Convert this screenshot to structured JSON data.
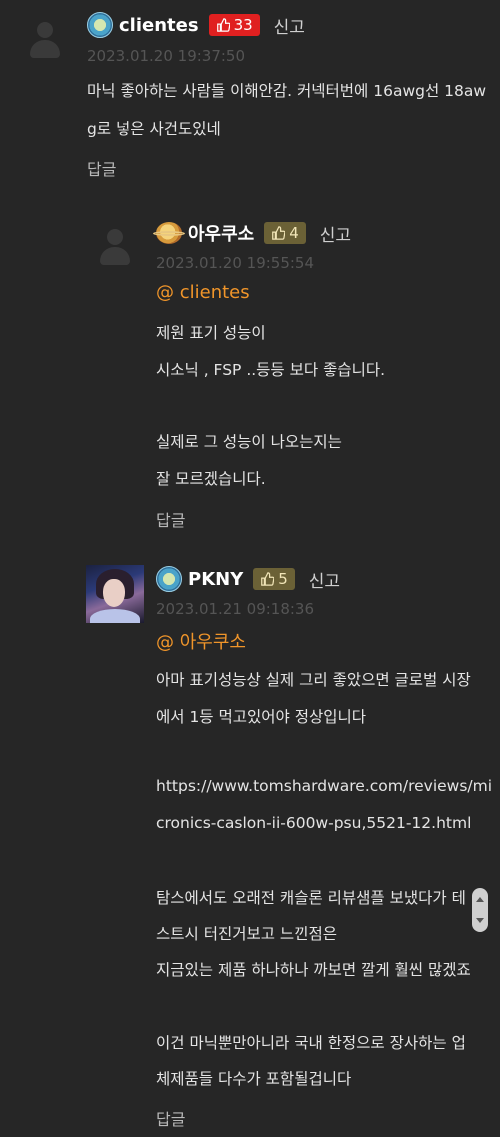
{
  "comments": [
    {
      "nick": "clientes",
      "likes": "33",
      "report": "신고",
      "date": "2023.01.20 19:37:50",
      "mention": "",
      "lines": [
        "마닉 좋아하는 사람들 이해안감. 커넥터번에 16awg선 18aw",
        "g로 넣은 사건도있네"
      ],
      "reply": "답글"
    },
    {
      "nick": "아우쿠소",
      "likes": "4",
      "report": "신고",
      "date": "2023.01.20 19:55:54",
      "mention": "@ clientes",
      "lines": [
        "제원 표기 성능이",
        "시소닉 , FSP ..등등 보다 좋습니다.",
        "",
        "실제로 그 성능이 나오는지는",
        "잘 모르겠습니다."
      ],
      "reply": "답글"
    },
    {
      "nick": "PKNY",
      "likes": "5",
      "report": "신고",
      "date": "2023.01.21 09:18:36",
      "mention": "@ 아우쿠소",
      "lines": [
        "아마 표기성능상 실제 그리 좋았으면 글로벌 시장",
        "에서 1등 먹고있어야 정상입니다",
        "",
        "https://www.tomshardware.com/reviews/mi",
        "cronics-caslon-ii-600w-psu,5521-12.html",
        "",
        "탐스에서도 오래전 캐슬론 리뷰샘플 보냈다가 테",
        "스트시 터진거보고 느낀점은",
        "지금있는 제품 하나하나 까보면 깔게 훨씬 많겠죠",
        "",
        "이건 마닉뿐만아니라 국내 한정으로 장사하는 업",
        "체제품들 다수가 포함될겁니다"
      ],
      "reply": "답글"
    }
  ],
  "colors": {
    "background": "#262626",
    "hot_like": "#e02020",
    "normal_like": "#6b6136",
    "mention": "#f0952a"
  },
  "icons": {
    "like": "thumbs-up-icon",
    "level_globe": "globe-level-icon",
    "level_planet": "planet-level-icon"
  }
}
